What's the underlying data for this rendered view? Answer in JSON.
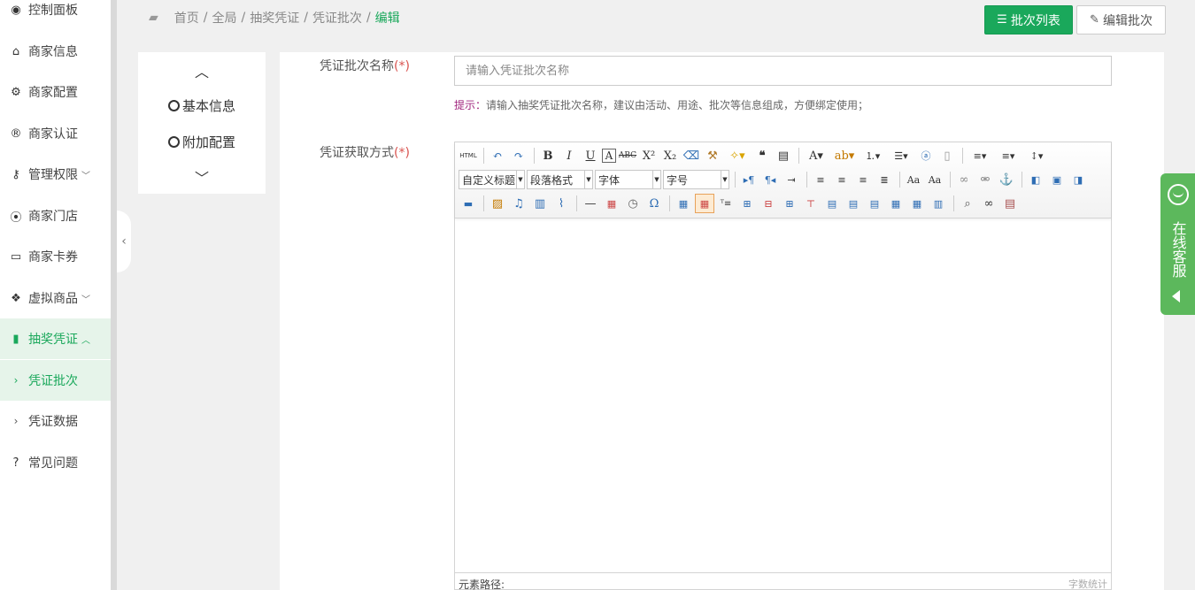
{
  "sidebar": {
    "items": [
      {
        "label": "控制面板",
        "icon": "dashboard-icon",
        "glyph": "◉"
      },
      {
        "label": "商家信息",
        "icon": "home-icon",
        "glyph": "⌂"
      },
      {
        "label": "商家配置",
        "icon": "gears-icon",
        "glyph": "⚙"
      },
      {
        "label": "商家认证",
        "icon": "registered-icon",
        "glyph": "®"
      },
      {
        "label": "管理权限",
        "icon": "key-icon",
        "glyph": "⚷",
        "chevron": "﹀"
      },
      {
        "label": "商家门店",
        "icon": "map-marker-icon",
        "glyph": "⦿"
      },
      {
        "label": "商家卡券",
        "icon": "credit-card-icon",
        "glyph": "▭"
      },
      {
        "label": "虚拟商品",
        "icon": "dropbox-icon",
        "glyph": "❖",
        "chevron": "﹀"
      },
      {
        "label": "抽奖凭证",
        "icon": "bookmark-icon",
        "glyph": "▮",
        "chevron": "︿"
      },
      {
        "label": "凭证批次",
        "icon": "chevron-right-icon",
        "glyph": "›"
      },
      {
        "label": "凭证数据",
        "icon": "chevron-right-icon",
        "glyph": "›"
      },
      {
        "label": "常见问题",
        "icon": "question-circle-icon",
        "glyph": "?"
      }
    ]
  },
  "breadcrumb": {
    "items": [
      "首页",
      "全局",
      "抽奖凭证",
      "凭证批次"
    ],
    "separator": "/",
    "current": "编辑"
  },
  "header": {
    "list_button": "批次列表",
    "edit_button": "编辑批次"
  },
  "stepnav": {
    "items": [
      "基本信息",
      "附加配置"
    ]
  },
  "form": {
    "name_label": "凭证批次名称",
    "name_placeholder": "请输入凭证批次名称",
    "required_mark": "(*)",
    "hint_label": "提示：",
    "hint_text": "请输入抽奖凭证批次名称，建议由活动、用途、批次等信息组成，方便绑定使用；",
    "method_label": "凭证获取方式"
  },
  "editor": {
    "custom_title": "自定义标题",
    "paragraph": "段落格式",
    "font_family": "字体",
    "font_size": "字号",
    "html_label": "HTML",
    "path_label": "元素路径:",
    "word_count": "字数统计"
  },
  "service": {
    "label": "在线客服"
  },
  "colors": {
    "primary": "#1aa85b",
    "service": "#5cb85c",
    "required": "#d9534f"
  }
}
